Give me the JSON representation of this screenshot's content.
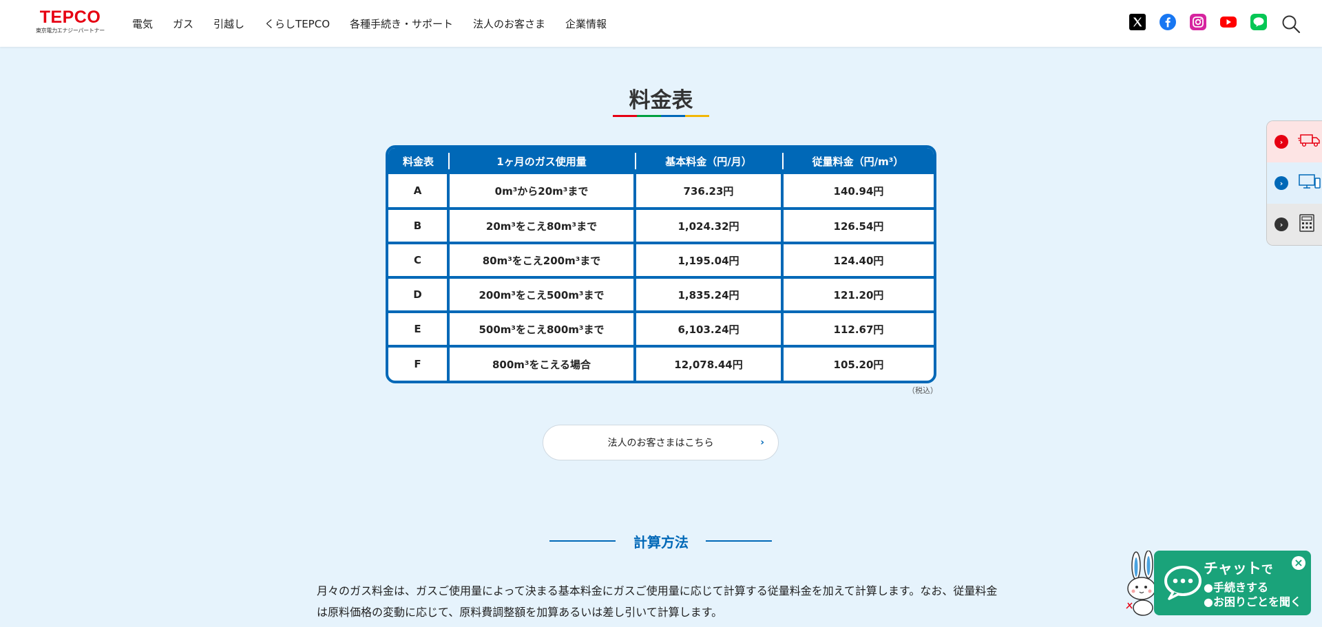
{
  "header": {
    "logo_text": "TEPCO",
    "logo_sub": "東京電力エナジーパートナー",
    "nav": [
      "電気",
      "ガス",
      "引越し",
      "くらしTEPCO",
      "各種手続き・サポート",
      "法人のお客さま",
      "企業情報"
    ],
    "social_icons": [
      "x-icon",
      "facebook-icon",
      "instagram-icon",
      "youtube-icon",
      "line-icon"
    ]
  },
  "title": "料金表",
  "title_bar_colors": [
    "#e60012",
    "#00a040",
    "#0068b7",
    "#f2b705"
  ],
  "table": {
    "headers": [
      "料金表",
      "1ヶ月のガス使用量",
      "基本料金（円/月）",
      "従量料金（円/m³）"
    ],
    "rows": [
      {
        "plan": "A",
        "usage": "0m³から20m³まで",
        "base": "736.23円",
        "unit": "140.94円"
      },
      {
        "plan": "B",
        "usage": "20m³をこえ80m³まで",
        "base": "1,024.32円",
        "unit": "126.54円"
      },
      {
        "plan": "C",
        "usage": "80m³をこえ200m³まで",
        "base": "1,195.04円",
        "unit": "124.40円"
      },
      {
        "plan": "D",
        "usage": "200m³をこえ500m³まで",
        "base": "1,835.24円",
        "unit": "121.20円"
      },
      {
        "plan": "E",
        "usage": "500m³をこえ800m³まで",
        "base": "6,103.24円",
        "unit": "112.67円"
      },
      {
        "plan": "F",
        "usage": "800m³をこえる場合",
        "base": "12,078.44円",
        "unit": "105.20円"
      }
    ],
    "note": "（税込）"
  },
  "corp_button": "法人のお客さまはこちら",
  "section_title": "計算方法",
  "description": "月々のガス料金は、ガスご使用量によって決まる基本料金にガスご使用量に応じて計算する従量料金を加えて計算します。なお、従量料金は原料価格の変動に応じて、原料費調整額を加算あるいは差し引いて計算します。",
  "side_tabs": [
    {
      "icon": "truck-icon",
      "bg": "#fde4e4",
      "dot": "#e60012"
    },
    {
      "icon": "computer-icon",
      "bg": "#e1f0fb",
      "dot": "#0068b7"
    },
    {
      "icon": "calculator-icon",
      "bg": "#e8e8e8",
      "dot": "#333333"
    }
  ],
  "chat": {
    "title": "チャット",
    "title_suffix": "で",
    "line1": "●手続きする",
    "line2": "●お困りごとを聞く",
    "close": "×"
  }
}
